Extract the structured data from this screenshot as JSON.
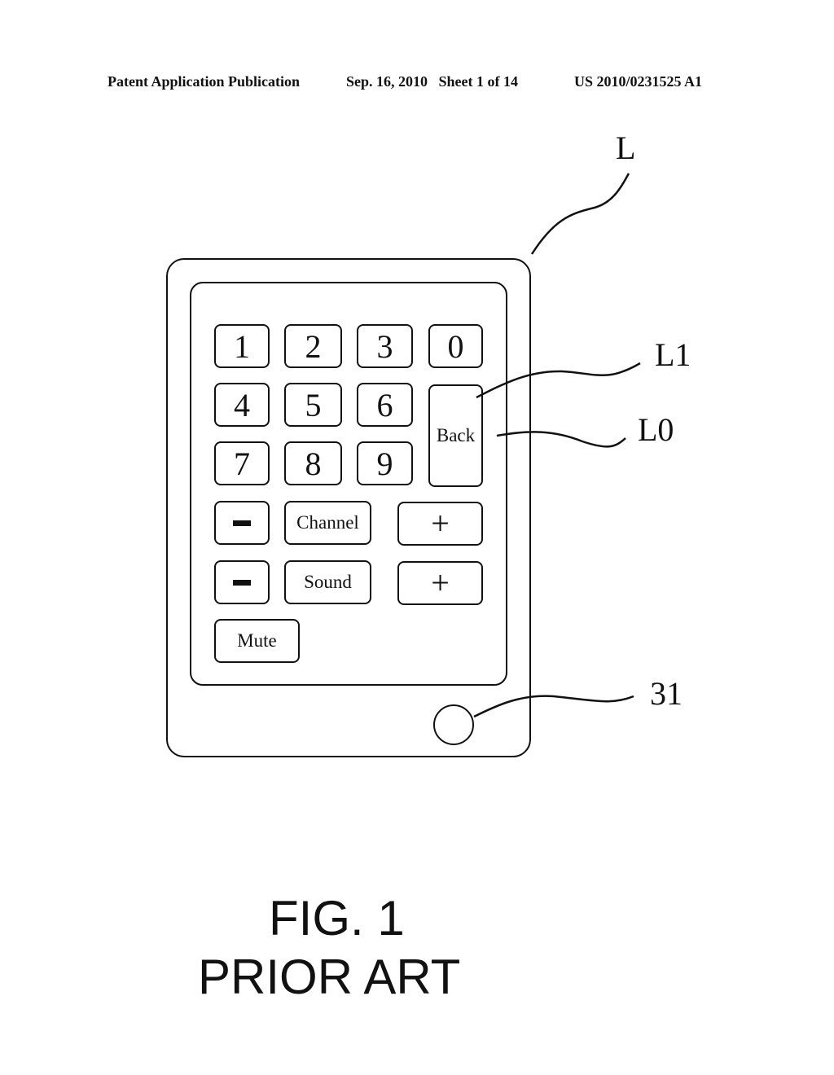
{
  "header": {
    "publication": "Patent Application Publication",
    "date_sheet": "Sep. 16, 2010   Sheet 1 of 14",
    "number": "US 2010/0231525 A1"
  },
  "keypad": {
    "digits": [
      "1",
      "2",
      "3",
      "0",
      "4",
      "5",
      "6",
      "7",
      "8",
      "9"
    ],
    "back": "Back",
    "channel": "Channel",
    "sound": "Sound",
    "mute": "Mute",
    "plus_symbol": "+"
  },
  "references": {
    "device": "L",
    "back_key_outer": "L1",
    "back_key_label": "L0",
    "home_button": "31"
  },
  "figure": {
    "number": "FIG. 1",
    "caption": "PRIOR ART"
  },
  "colors": {
    "ink": "#111111",
    "paper": "#ffffff"
  }
}
